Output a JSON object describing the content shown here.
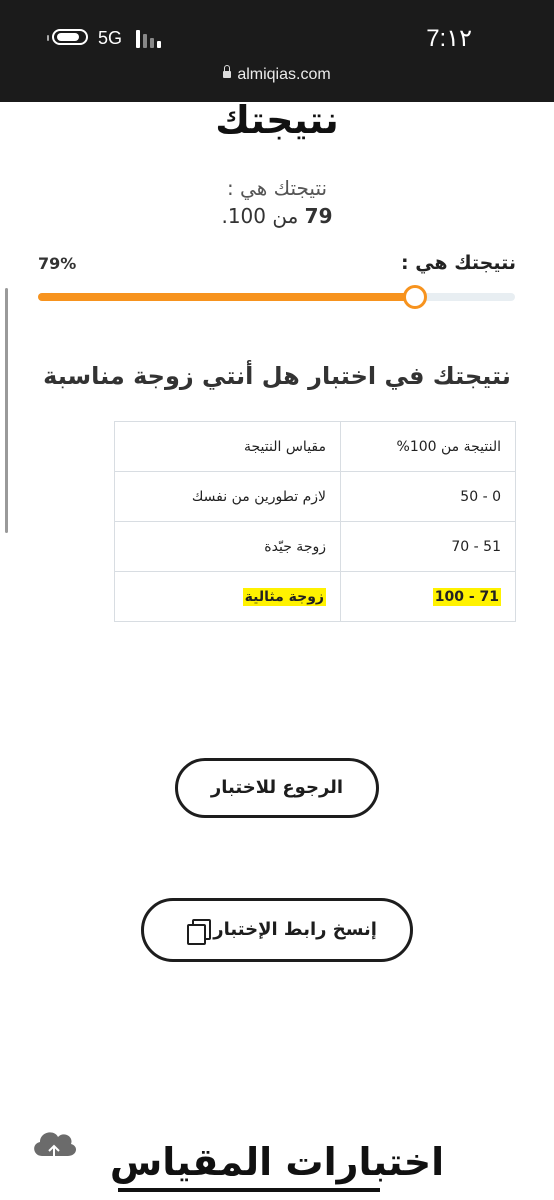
{
  "status_bar": {
    "time": "7:١٢",
    "network": "5G",
    "url": "almiqias.com"
  },
  "page": {
    "title": "نتيجتك",
    "result_line1": "نتيجتك هي :",
    "result_score": "79",
    "result_line2_rest": " من 100."
  },
  "progress": {
    "label": "نتيجتك هي :",
    "percent_label": "79%",
    "value": 79
  },
  "section": {
    "heading": "نتيجتك في اختبار هل أنتي زوجة مناسبة"
  },
  "table": {
    "headers": [
      "النتيجة من 100%",
      "مقياس النتيجة"
    ],
    "rows": [
      [
        "0 - 50",
        "لازم تطورين من نفسك"
      ],
      [
        "51 - 70",
        "زوجة جيّدة"
      ],
      [
        "71 - 100",
        "زوجة مثالية"
      ]
    ],
    "highlight_color": "#fff200"
  },
  "buttons": {
    "back": "الرجوع للاختبار",
    "copy": "إنسخ رابط الإختبار"
  },
  "footer": {
    "title": "اختبارات المقياس"
  },
  "colors": {
    "accent": "#f7931e",
    "status_bg": "#1b1b1b"
  },
  "icons": [
    "lock-icon",
    "battery-icon",
    "signal-icon",
    "copy-icon",
    "cloud-upload-icon"
  ]
}
